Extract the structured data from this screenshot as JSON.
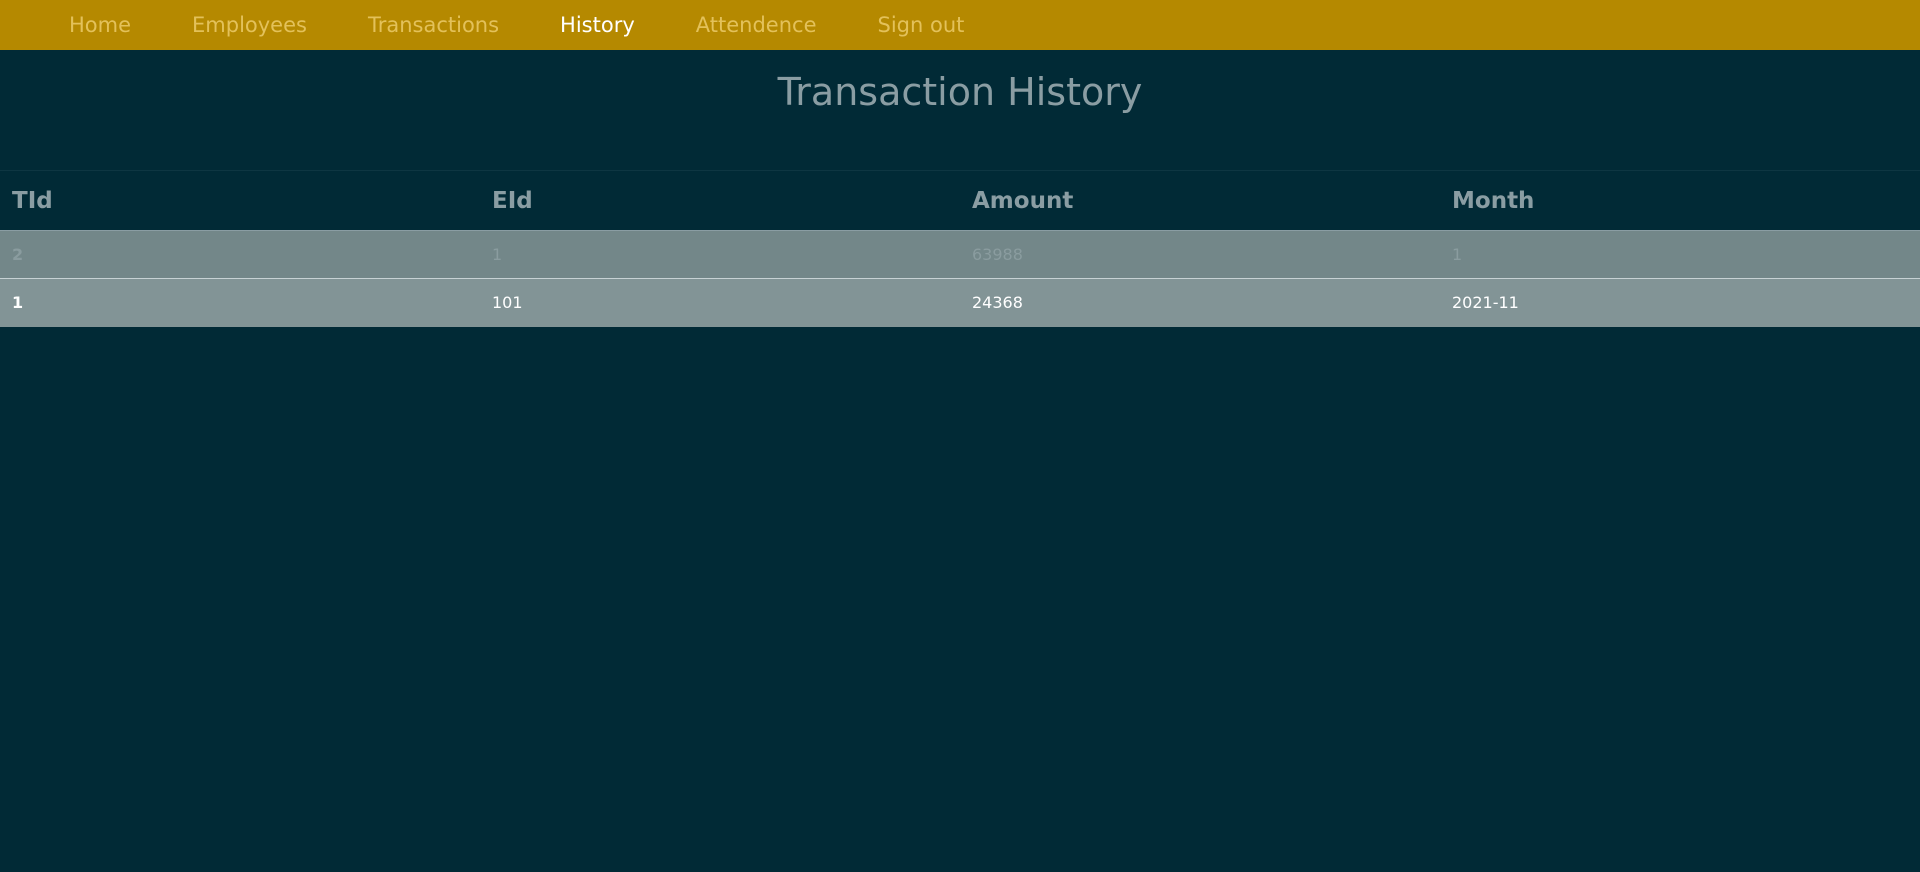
{
  "nav": {
    "items": [
      {
        "label": "Home"
      },
      {
        "label": "Employees"
      },
      {
        "label": "Transactions"
      },
      {
        "label": "History"
      },
      {
        "label": "Attendence"
      },
      {
        "label": "Sign out"
      }
    ],
    "active": "History"
  },
  "page": {
    "title": "Transaction History"
  },
  "table": {
    "headers": [
      "TId",
      "EId",
      "Amount",
      "Month"
    ],
    "rows": [
      {
        "tid": "2",
        "eid": "1",
        "amount": "63988",
        "month": "1"
      },
      {
        "tid": "1",
        "eid": "101",
        "amount": "24368",
        "month": "2021-11"
      }
    ]
  },
  "colors": {
    "navbar": "#b58900",
    "background": "#012a36",
    "accent_text": "#8a9da3"
  }
}
